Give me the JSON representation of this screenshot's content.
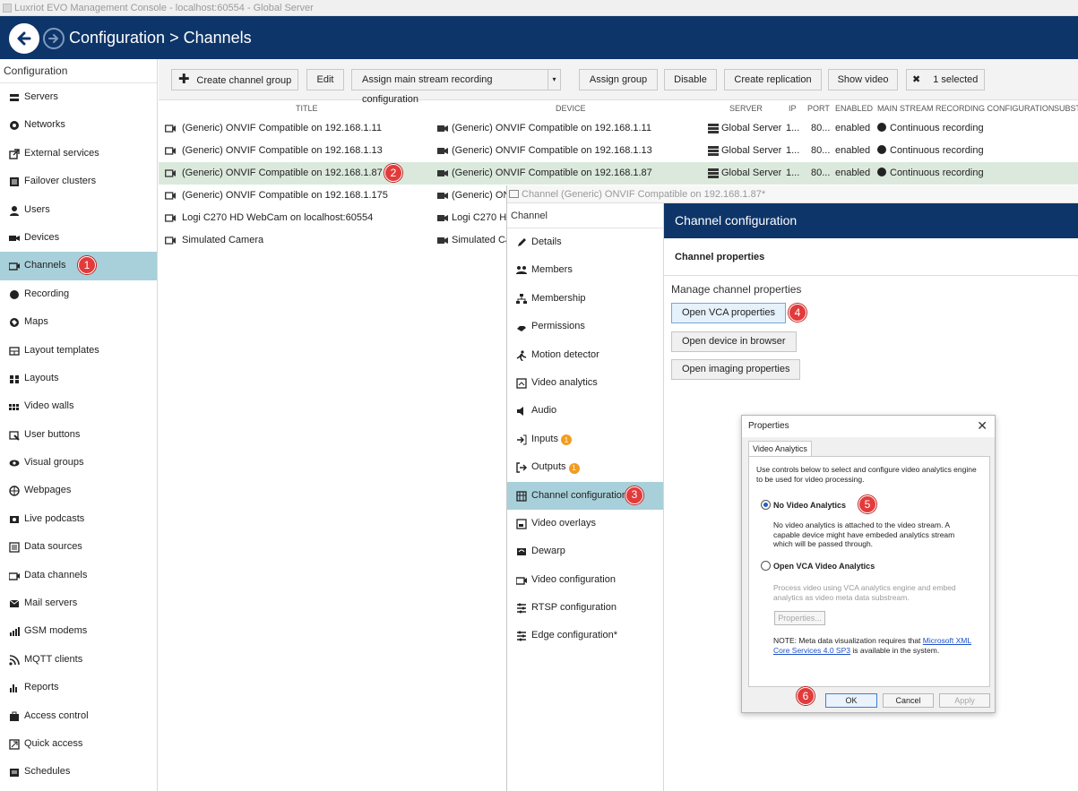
{
  "window": {
    "title": "Luxriot EVO Management Console - localhost:60554 - Global Server"
  },
  "header": {
    "title": "Configuration > Channels"
  },
  "sidebar": {
    "heading": "Configuration",
    "items": [
      {
        "label": "Servers"
      },
      {
        "label": "Networks"
      },
      {
        "label": "External services"
      },
      {
        "label": "Failover clusters"
      },
      {
        "label": "Users"
      },
      {
        "label": "Devices"
      },
      {
        "label": "Channels",
        "badge": "1"
      },
      {
        "label": "Recording"
      },
      {
        "label": "Maps"
      },
      {
        "label": "Layout templates"
      },
      {
        "label": "Layouts"
      },
      {
        "label": "Video walls"
      },
      {
        "label": "User buttons"
      },
      {
        "label": "Visual groups"
      },
      {
        "label": "Webpages"
      },
      {
        "label": "Live podcasts"
      },
      {
        "label": "Data sources"
      },
      {
        "label": "Data channels"
      },
      {
        "label": "Mail servers"
      },
      {
        "label": "GSM modems"
      },
      {
        "label": "MQTT clients"
      },
      {
        "label": "Reports"
      },
      {
        "label": "Access control"
      },
      {
        "label": "Quick access"
      },
      {
        "label": "Schedules"
      }
    ]
  },
  "toolbar": {
    "create_group": "Create channel group",
    "edit": "Edit",
    "assign_main": "Assign main stream recording configuration",
    "assign_group": "Assign group",
    "disable": "Disable",
    "create_replication": "Create replication",
    "show_video": "Show video",
    "selected": "1 selected"
  },
  "table": {
    "columns": {
      "title": "TITLE",
      "device": "DEVICE",
      "server": "SERVER",
      "ip": "IP",
      "port": "PORT",
      "enabled": "ENABLED",
      "recording": "MAIN STREAM RECORDING CONFIGURATION",
      "subst": "SUBST"
    },
    "rows": [
      {
        "title": "(Generic) ONVIF Compatible on 192.168.1.11",
        "device": "(Generic) ONVIF Compatible on 192.168.1.11",
        "server": "Global Server",
        "ip": "1...",
        "port": "80...",
        "enabled": "enabled",
        "recording": "Continuous recording"
      },
      {
        "title": "(Generic) ONVIF Compatible on 192.168.1.13",
        "device": "(Generic) ONVIF Compatible on 192.168.1.13",
        "server": "Global Server",
        "ip": "1...",
        "port": "80...",
        "enabled": "enabled",
        "recording": "Continuous recording"
      },
      {
        "title": "(Generic) ONVIF Compatible on 192.168.1.87",
        "device": "(Generic) ONVIF Compatible on 192.168.1.87",
        "server": "Global Server",
        "ip": "1...",
        "port": "80...",
        "enabled": "enabled",
        "recording": "Continuous recording",
        "badge": "2"
      },
      {
        "title": "(Generic) ONVIF Compatible on 192.168.1.175",
        "device": "(Generic) ONVIF"
      },
      {
        "title": "Logi C270 HD WebCam on localhost:60554",
        "device": "Logi C270 H"
      },
      {
        "title": "Simulated Camera",
        "device": "Simulated Ca"
      }
    ]
  },
  "channel_window": {
    "title": "Channel (Generic) ONVIF Compatible on 192.168.1.87*",
    "nav_heading": "Channel",
    "nav": [
      {
        "label": "Details"
      },
      {
        "label": "Members"
      },
      {
        "label": "Membership"
      },
      {
        "label": "Permissions"
      },
      {
        "label": "Motion detector"
      },
      {
        "label": "Video analytics"
      },
      {
        "label": "Audio"
      },
      {
        "label": "Inputs",
        "count": "1"
      },
      {
        "label": "Outputs",
        "count": "1"
      },
      {
        "label": "Channel configuration",
        "badge": "3"
      },
      {
        "label": "Video overlays"
      },
      {
        "label": "Dewarp"
      },
      {
        "label": "Video configuration"
      },
      {
        "label": "RTSP configuration"
      },
      {
        "label": "Edge configuration*"
      }
    ],
    "config": {
      "heading": "Channel configuration",
      "subheading": "Channel properties",
      "manage_label": "Manage channel properties",
      "open_vca": "Open VCA properties",
      "open_vca_badge": "4",
      "open_device": "Open device in browser",
      "open_imaging": "Open imaging properties"
    }
  },
  "properties_dialog": {
    "title": "Properties",
    "close": "✕",
    "tab": "Video Analytics",
    "intro": "Use controls below to select and configure video analytics engine to be used for video processing.",
    "option1_label": "No Video Analytics",
    "option1_badge": "5",
    "option1_desc": "No video analytics is attached to the video stream. A capable device might have embeded analytics stream which will be passed through.",
    "option2_label": "Open VCA Video Analytics",
    "option2_desc": "Process video using VCA analytics engine and embed analytics as video meta data substream.",
    "properties_button": "Properties...",
    "note_prefix": "NOTE: Meta data visualization requires that ",
    "note_link": "Microsoft XML Core Services 4.0 SP3",
    "note_suffix": " is available in the system.",
    "ok": "OK",
    "ok_badge": "6",
    "cancel": "Cancel",
    "apply": "Apply"
  },
  "colors": {
    "header_bg": "#0e3569",
    "active_bg": "#a8d0da",
    "selected_row": "#dbe9dd",
    "badge": "#e23b3b",
    "count_badge": "#f39c1f"
  }
}
